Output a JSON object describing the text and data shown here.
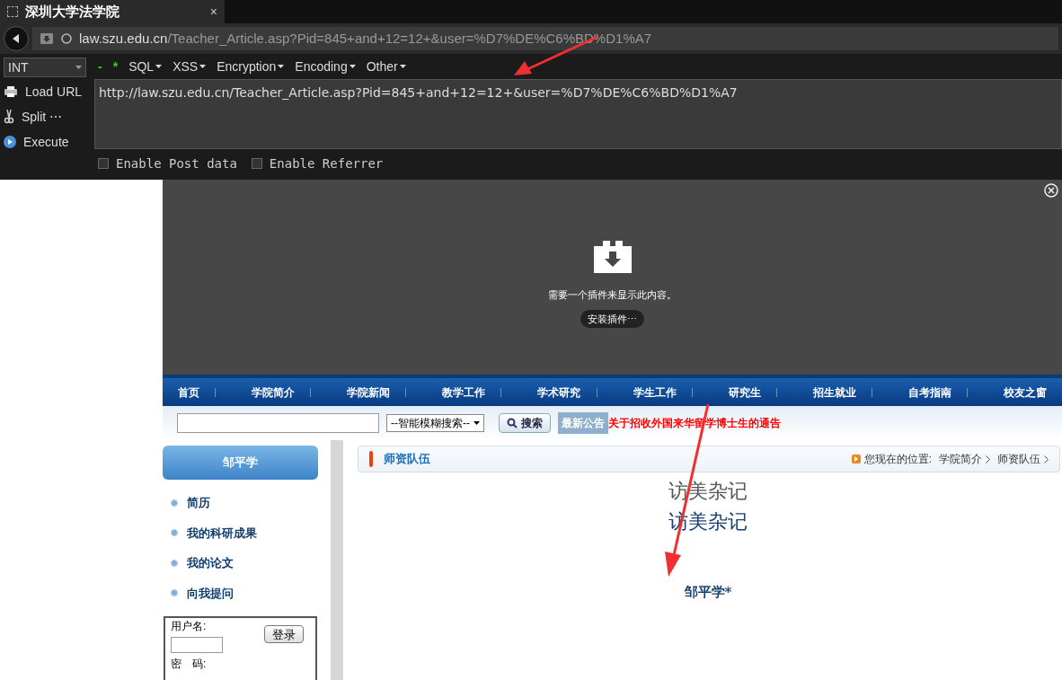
{
  "browser": {
    "tab_title": "深圳大学法学院",
    "close": "×",
    "url_host": "law.szu.edu.cn",
    "url_path": "/Teacher_Article.asp?Pid=845+and+12=12+&user=%D7%DE%C6%BD%D1%A7"
  },
  "hackbar": {
    "select": "INT",
    "quick_buttons": [
      "-",
      "*"
    ],
    "menus": [
      "SQL",
      "XSS",
      "Encryption",
      "Encoding",
      "Other"
    ],
    "actions": [
      {
        "kind": "load",
        "label": "Load URL"
      },
      {
        "kind": "split",
        "label": "Split ⋯"
      },
      {
        "kind": "execute",
        "label": "Execute"
      }
    ],
    "url_value": "http://law.szu.edu.cn/Teacher_Article.asp?Pid=845+and+12=12+&user=%D7%DE%C6%BD%D1%A7",
    "options": [
      {
        "label": "Enable Post data",
        "checked": false
      },
      {
        "label": "Enable Referrer",
        "checked": false
      }
    ]
  },
  "plugin": {
    "message": "需要一个插件来显示此内容。",
    "button": "安装插件⋯"
  },
  "nav": [
    "首页",
    "学院简介",
    "学院新闻",
    "教学工作",
    "学术研究",
    "学生工作",
    "研究生",
    "招生就业",
    "自考指南",
    "校友之窗"
  ],
  "search": {
    "select": "--智能模糊搜索--",
    "button": "搜索",
    "notice_label": "最新公告",
    "notice": "关于招收外国来华留学博士生的通告"
  },
  "sidebar": {
    "title": "邹平学",
    "items": [
      "简历",
      "我的科研成果",
      "我的论文",
      "向我提问"
    ],
    "login": {
      "username_label": "用户名:",
      "button": "登录",
      "password_label": "密　码:"
    }
  },
  "breadcrumb": {
    "section": "师资队伍",
    "location_label": "您现在的位置:",
    "crumbs": [
      "学院简介",
      "师资队伍"
    ]
  },
  "article": {
    "title_gray": "访美杂记",
    "title_blue": "访美杂记",
    "author": "邹平学*"
  }
}
